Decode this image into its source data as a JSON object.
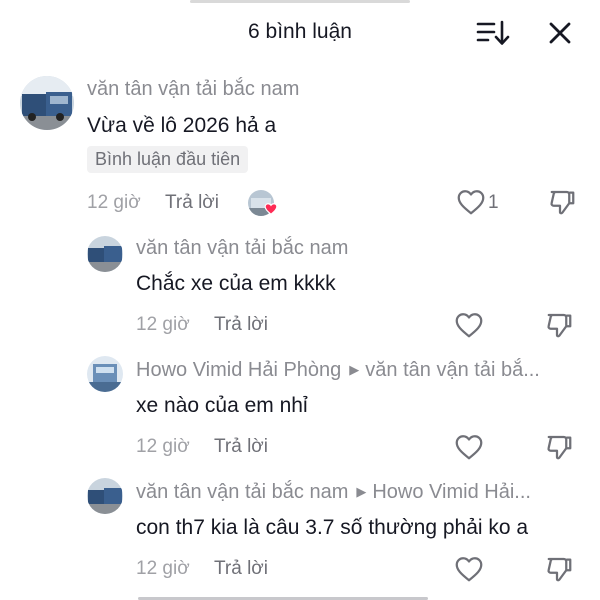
{
  "header": {
    "title": "6 bình luận",
    "sort_icon": "sort-icon",
    "close_icon": "close-icon"
  },
  "colors": {
    "text_primary": "#161823",
    "text_secondary": "#8a8b91",
    "heart_red": "#fe2c55",
    "badge_bg": "#f1f1f2"
  },
  "comments": [
    {
      "username": "văn tân vận tải bắc nam",
      "text": "Vừa về lô 2026 hả a",
      "badge": "Bình luận đầu tiên",
      "time": "12 giờ",
      "reply_label": "Trả lời",
      "likes": "1",
      "creator_liked": true
    },
    {
      "username": "văn tân vận tải bắc nam",
      "text": "Chắc xe của em kkkk",
      "time": "12 giờ",
      "reply_label": "Trả lời"
    },
    {
      "username": "Howo Vimid Hải Phòng",
      "reply_to": "văn tân vận tải bắ...",
      "text": "xe nào của em nhỉ",
      "time": "12 giờ",
      "reply_label": "Trả lời"
    },
    {
      "username": "văn tân vận tải bắc nam",
      "reply_to": "Howo Vimid Hải...",
      "text": "con th7 kia là câu 3.7 số thường phải ko a",
      "time": "12 giờ",
      "reply_label": "Trả lời"
    }
  ]
}
